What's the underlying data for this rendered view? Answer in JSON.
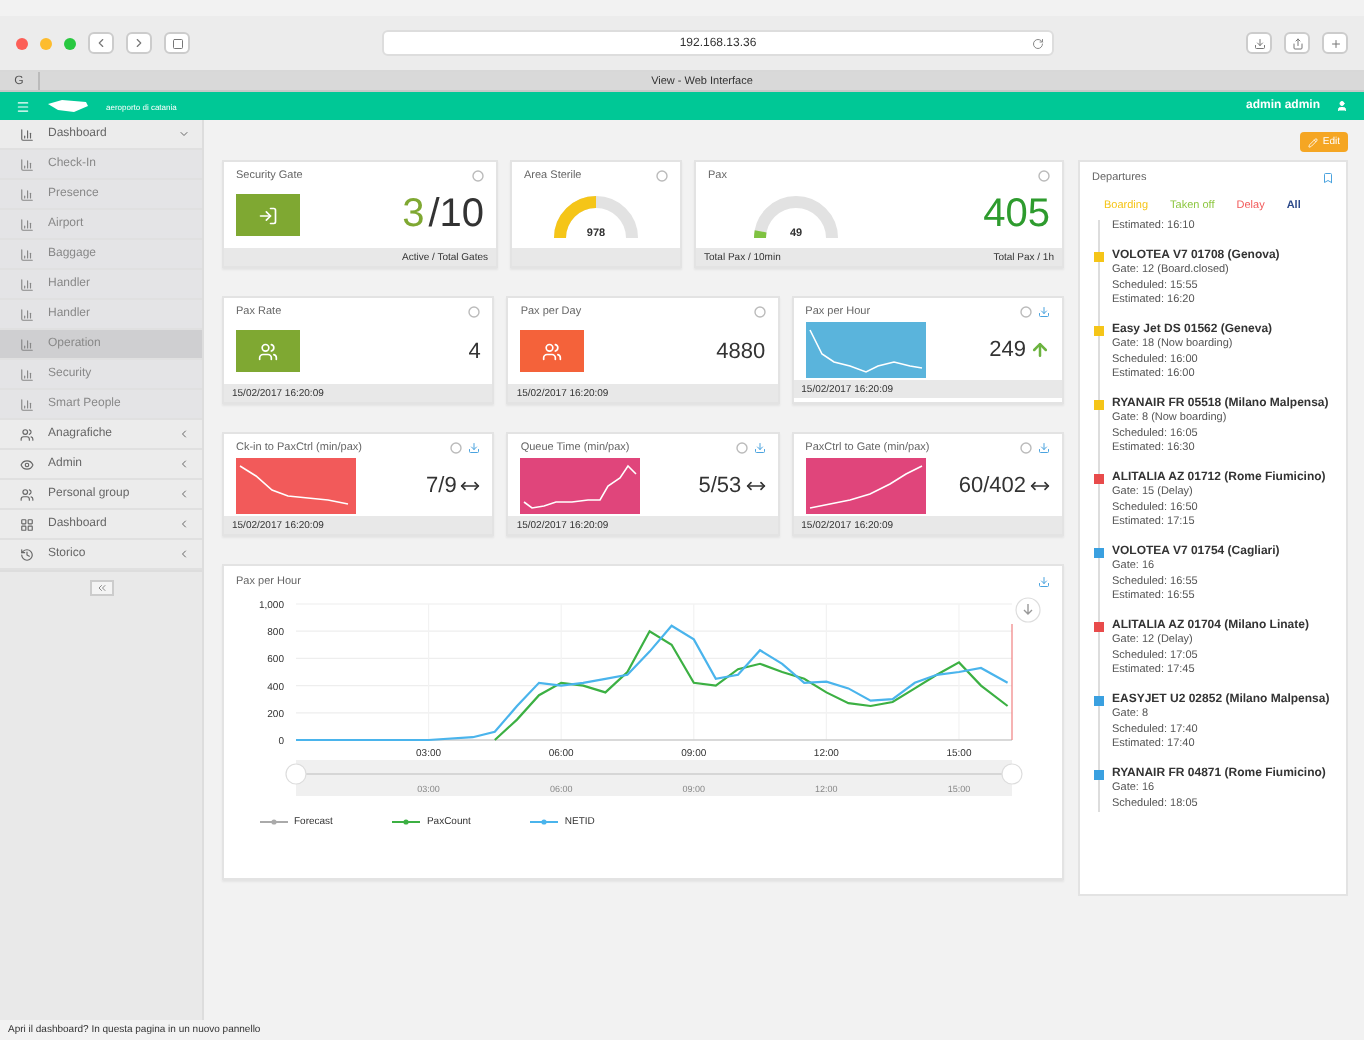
{
  "browser": {
    "url": "192.168.13.36",
    "tab_title": "View - Web Interface",
    "side_tab": "G"
  },
  "header": {
    "logo_text": "aeroporto di catania",
    "user": "admin admin"
  },
  "sidebar": {
    "items": [
      {
        "label": "Dashboard",
        "expanded": true,
        "children": [
          {
            "label": "Check-In",
            "selected": false
          },
          {
            "label": "Presence",
            "selected": false
          },
          {
            "label": "Airport",
            "selected": false
          },
          {
            "label": "Baggage",
            "selected": false
          },
          {
            "label": "Handler",
            "selected": false
          },
          {
            "label": "Handler",
            "selected": false
          },
          {
            "label": "Operation",
            "selected": true
          },
          {
            "label": "Security",
            "selected": false
          },
          {
            "label": "Smart People",
            "selected": false
          }
        ]
      },
      {
        "label": "Anagrafiche",
        "expanded": false
      },
      {
        "label": "Admin",
        "expanded": false
      },
      {
        "label": "Personal group",
        "expanded": false
      },
      {
        "label": "Dashboard",
        "expanded": false
      },
      {
        "label": "Storico",
        "expanded": false
      }
    ]
  },
  "edit_button": "Edit",
  "card_rows": [
    [
      {
        "kind": "icon_value",
        "title": "Security Gate",
        "color": "#7fa832",
        "value": "3",
        "value_suffix": "/10",
        "footer": "Active / Total Gates"
      },
      {
        "kind": "gauge",
        "title": "Area Sterile",
        "reading": "978"
      },
      {
        "kind": "gauge_value",
        "title": "Pax",
        "reading": "49",
        "value": "405",
        "footer_left": "Total Pax / 10min",
        "footer": "Total Pax / 1h"
      }
    ],
    [
      {
        "kind": "icon_value",
        "title": "Pax Rate",
        "color": "#7fa832",
        "value": "4",
        "footer_left": "15/02/2017 16:20:09"
      },
      {
        "kind": "icon_value",
        "title": "Pax per Day",
        "color": "#f4623a",
        "value": "4880",
        "footer_left": "15/02/2017 16:20:09"
      },
      {
        "kind": "spark_value",
        "title": "Pax per Hour",
        "color": "#5ab4dc",
        "value": "249",
        "rising": true,
        "footer_left": "15/02/2017 16:20:09"
      }
    ],
    [
      {
        "kind": "spark_value",
        "title": "Ck-in to PaxCtrl (min/pax)",
        "color": "#f25a5a",
        "value": "7/9",
        "rising": false,
        "footer_left": "15/02/2017 16:20:09"
      },
      {
        "kind": "spark_value",
        "title": "Queue Time (min/pax)",
        "color": "#e0457b",
        "value": "5/53",
        "rising": false,
        "footer_left": "15/02/2017 16:20:09"
      },
      {
        "kind": "spark_value",
        "title": "PaxCtrl to Gate (min/pax)",
        "color": "#e0457b",
        "value": "60/402",
        "rising": false,
        "footer_left": "15/02/2017 16:20:09"
      }
    ]
  ],
  "chart_card": {
    "title": "Pax per Hour",
    "navigator_labels": [
      "03:00",
      "06:00",
      "09:00",
      "12:00",
      "15:00"
    ],
    "chart_data": {
      "type": "line",
      "grid": true,
      "legend": "bottom",
      "xlim": [
        0,
        16.2
      ],
      "ylim": [
        0,
        1000
      ],
      "yticks": [
        0,
        {
          "value": 200,
          "label": "200"
        },
        {
          "value": 400,
          "label": "400"
        },
        {
          "value": 600,
          "label": "600"
        },
        {
          "value": 800,
          "label": "800"
        },
        {
          "value": 1000,
          "label": "1,000"
        }
      ],
      "xticks": [
        {
          "value": 3,
          "label": "03:00"
        },
        {
          "value": 6,
          "label": "06:00"
        },
        {
          "value": 9,
          "label": "09:00"
        },
        {
          "value": 12,
          "label": "12:00"
        },
        {
          "value": 15,
          "label": "15:00"
        }
      ],
      "x": [
        0,
        1,
        2,
        3,
        4,
        4.5,
        5,
        5.5,
        6,
        6.5,
        7,
        7.5,
        8,
        8.5,
        9,
        9.5,
        10,
        10.5,
        11,
        11.5,
        12,
        12.5,
        13,
        13.5,
        14,
        14.5,
        15,
        15.5,
        16.1
      ],
      "series": [
        {
          "name": "Forecast",
          "color": "#aaaaaa",
          "values": [
            null,
            null,
            null,
            null,
            null,
            null,
            null,
            null,
            null,
            null,
            null,
            null,
            null,
            null,
            null,
            null,
            null,
            null,
            null,
            null,
            null,
            null,
            null,
            null,
            null,
            null,
            null,
            null,
            null
          ]
        },
        {
          "name": "PaxCount",
          "color": "#3cb043",
          "values": [
            null,
            null,
            null,
            null,
            null,
            0,
            150,
            330,
            420,
            400,
            350,
            500,
            800,
            700,
            420,
            400,
            520,
            560,
            500,
            450,
            350,
            270,
            250,
            280,
            380,
            480,
            570,
            400,
            250
          ]
        },
        {
          "name": "NETID",
          "color": "#4ab4ec",
          "values": [
            0,
            0,
            0,
            0,
            20,
            60,
            250,
            420,
            400,
            420,
            450,
            480,
            650,
            840,
            740,
            450,
            480,
            660,
            560,
            420,
            430,
            380,
            290,
            300,
            420,
            480,
            500,
            530,
            420
          ]
        }
      ]
    }
  },
  "departures": {
    "title": "Departures",
    "filters": [
      {
        "label": "Boarding",
        "color": "#f5c518",
        "selected": false
      },
      {
        "label": "Taken off",
        "color": "#8cc63f",
        "selected": false
      },
      {
        "label": "Delay",
        "color": "#f25a5a",
        "selected": false
      },
      {
        "label": "All",
        "color": "#2d4a8a",
        "selected": true
      }
    ],
    "flights": [
      {
        "lines": [
          "Estimated: 16:10"
        ]
      },
      {
        "title": "VOLOTEA V7 01708 (Genova)",
        "color": "#f5c518",
        "lines": [
          "Gate: 12 (Board.closed)",
          "Scheduled: 15:55",
          "Estimated: 16:20"
        ]
      },
      {
        "title": "Easy Jet DS 01562 (Geneva)",
        "color": "#f5c518",
        "lines": [
          "Gate: 18 (Now boarding)",
          "Scheduled: 16:00",
          "Estimated: 16:00"
        ]
      },
      {
        "title": "RYANAIR FR 05518 (Milano Malpensa)",
        "color": "#f5c518",
        "lines": [
          "Gate: 8 (Now boarding)",
          "Scheduled: 16:05",
          "Estimated: 16:30"
        ]
      },
      {
        "title": "ALITALIA AZ 01712 (Rome Fiumicino)",
        "color": "#e84b4b",
        "lines": [
          "Gate: 15 (Delay)",
          "Scheduled: 16:50",
          "Estimated: 17:15"
        ]
      },
      {
        "title": "VOLOTEA V7 01754 (Cagliari)",
        "color": "#3aa0e0",
        "lines": [
          "Gate: 16",
          "Scheduled: 16:55",
          "Estimated: 16:55"
        ]
      },
      {
        "title": "ALITALIA AZ 01704 (Milano Linate)",
        "color": "#e84b4b",
        "lines": [
          "Gate: 12 (Delay)",
          "Scheduled: 17:05",
          "Estimated: 17:45"
        ]
      },
      {
        "title": "EASYJET U2 02852 (Milano Malpensa)",
        "color": "#3aa0e0",
        "lines": [
          "Gate: 8",
          "Scheduled: 17:40",
          "Estimated: 17:40"
        ]
      },
      {
        "title": "RYANAIR FR 04871 (Rome Fiumicino)",
        "color": "#3aa0e0",
        "lines": [
          "Gate: 16",
          "Scheduled: 18:05"
        ]
      }
    ]
  },
  "status_bar": "Apri il dashboard? In questa pagina in un nuovo pannello"
}
